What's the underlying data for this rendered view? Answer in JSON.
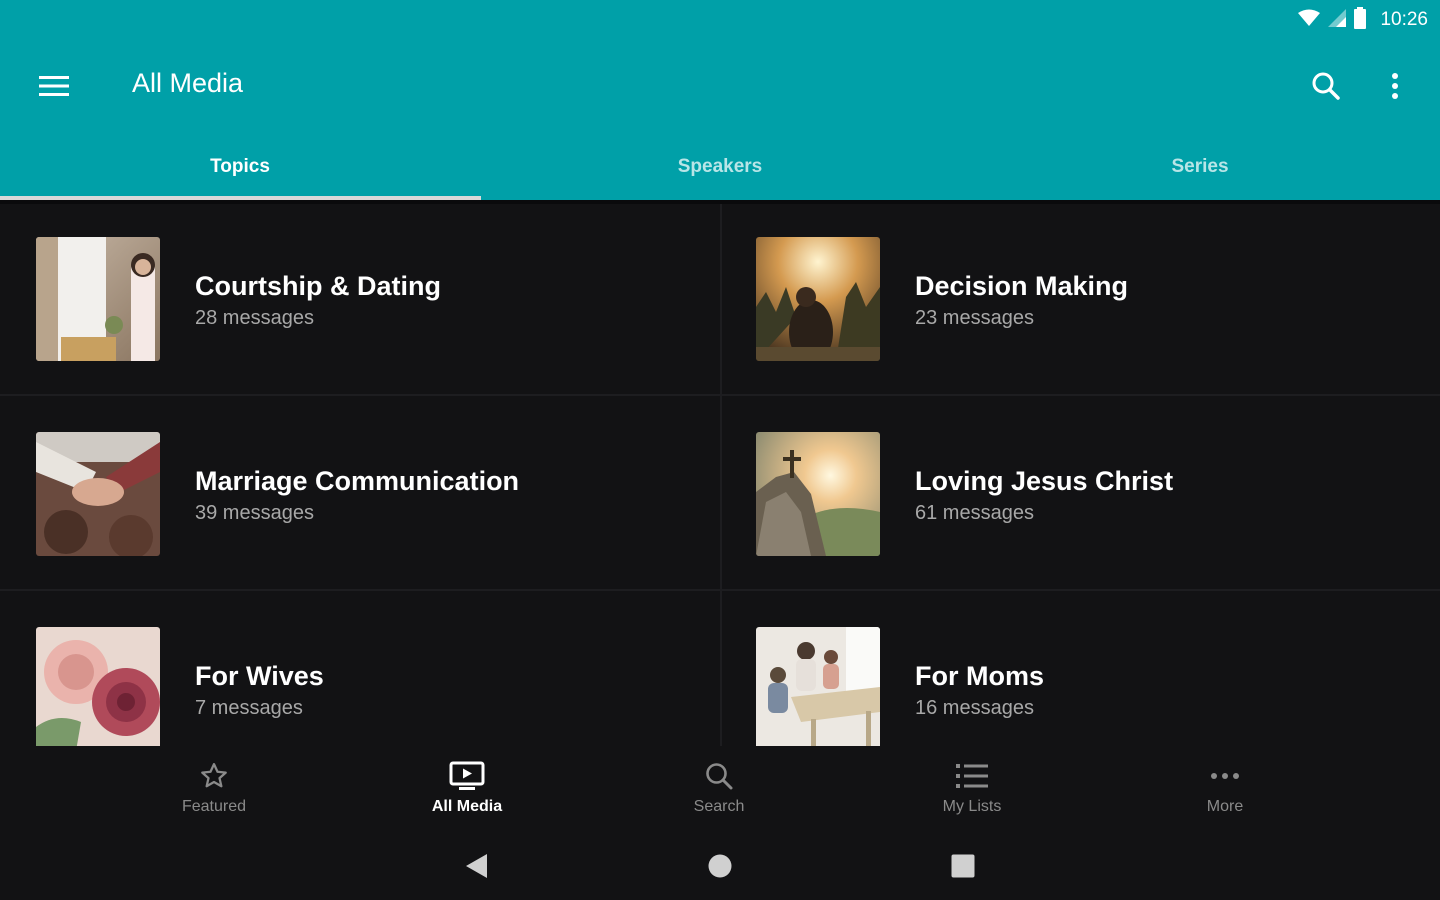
{
  "status": {
    "time": "10:26"
  },
  "appbar": {
    "title": "All Media"
  },
  "tabs": [
    {
      "label": "Topics",
      "active": true
    },
    {
      "label": "Speakers",
      "active": false
    },
    {
      "label": "Series",
      "active": false
    }
  ],
  "topics": [
    {
      "title": "Courtship & Dating",
      "count": "28 messages"
    },
    {
      "title": "Decision Making",
      "count": "23 messages"
    },
    {
      "title": "Marriage Communication",
      "count": "39 messages"
    },
    {
      "title": "Loving Jesus Christ",
      "count": "61 messages"
    },
    {
      "title": "For Wives",
      "count": "7 messages"
    },
    {
      "title": "For Moms",
      "count": "16 messages"
    }
  ],
  "bottom_nav": [
    {
      "label": "Featured",
      "icon": "star-outline-icon",
      "active": false
    },
    {
      "label": "All Media",
      "icon": "tv-play-icon",
      "active": true
    },
    {
      "label": "Search",
      "icon": "search-icon",
      "active": false
    },
    {
      "label": "My Lists",
      "icon": "list-icon",
      "active": false
    },
    {
      "label": "More",
      "icon": "more-horizontal-icon",
      "active": false
    }
  ],
  "colors": {
    "header": "#00A0A8",
    "background": "#121214",
    "tab_indicator": "#d9d9d9"
  }
}
